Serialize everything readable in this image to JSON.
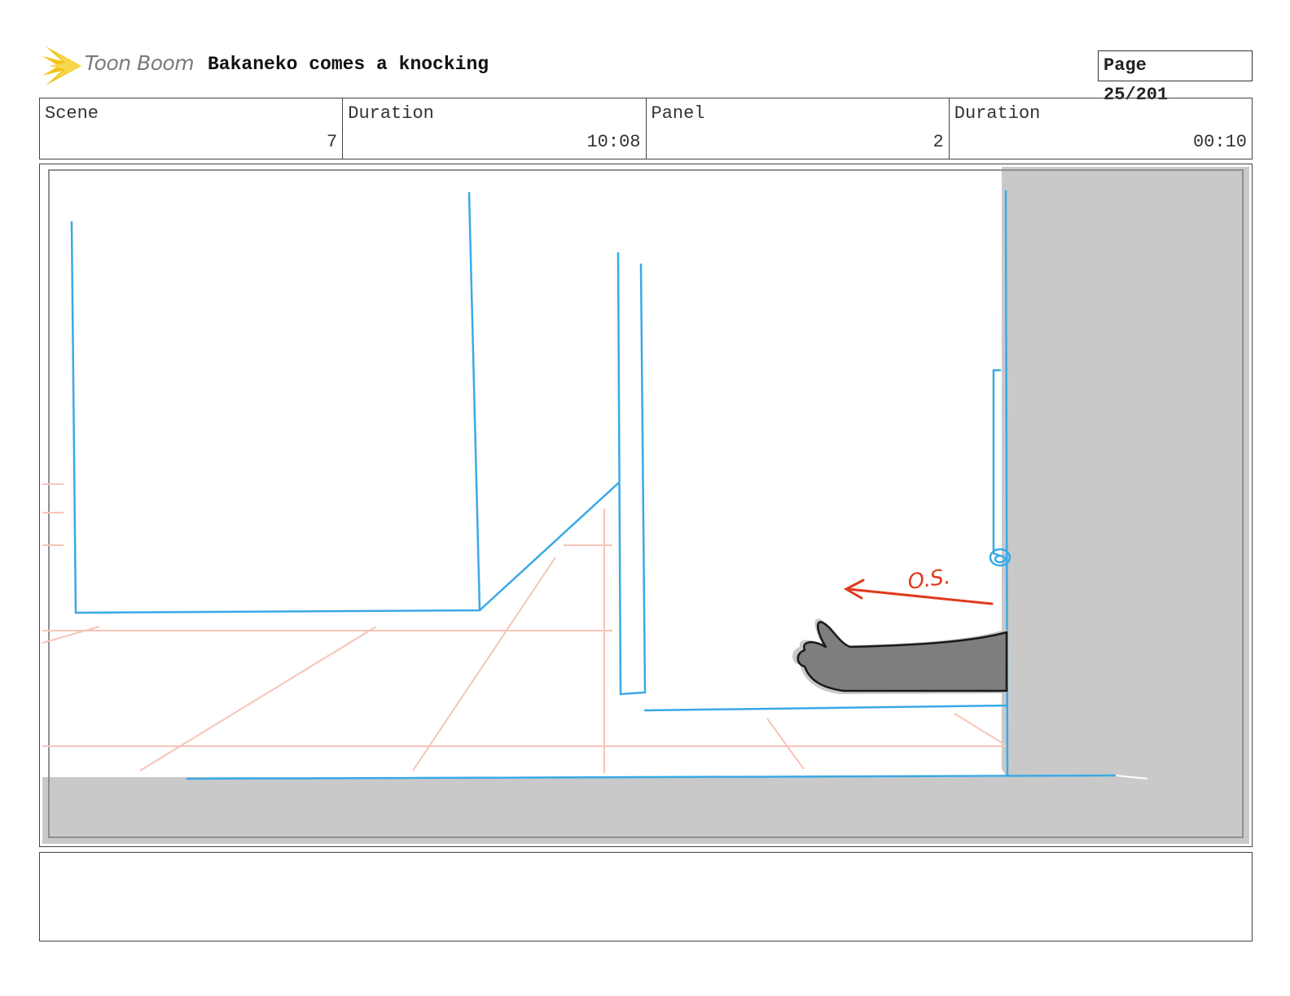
{
  "header": {
    "logo_text": "Toon Boom",
    "title": "Bakaneko comes a knocking",
    "page_label": "Page",
    "page_value": "25/201"
  },
  "info": {
    "scene_label": "Scene",
    "scene_value": "7",
    "scene_duration_label": "Duration",
    "scene_duration_value": "10:08",
    "panel_label": "Panel",
    "panel_value": "2",
    "panel_duration_label": "Duration",
    "panel_duration_value": "00:10"
  },
  "panel": {
    "annotation": "O.S.",
    "colors": {
      "layout_lines": "#3aa9e6",
      "perspective_lines": "#f6c4b8",
      "shadow": "#c9c9c9",
      "arm": "#7e7e7e",
      "annotation": "#e03a1e"
    }
  },
  "notes": {
    "text": ""
  }
}
